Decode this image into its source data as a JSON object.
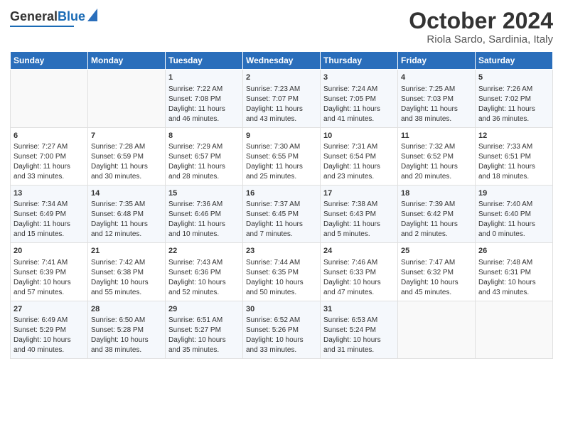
{
  "logo": {
    "general": "General",
    "blue": "Blue"
  },
  "title": {
    "month_year": "October 2024",
    "location": "Riola Sardo, Sardinia, Italy"
  },
  "headers": [
    "Sunday",
    "Monday",
    "Tuesday",
    "Wednesday",
    "Thursday",
    "Friday",
    "Saturday"
  ],
  "weeks": [
    [
      {
        "day": "",
        "lines": []
      },
      {
        "day": "",
        "lines": []
      },
      {
        "day": "1",
        "lines": [
          "Sunrise: 7:22 AM",
          "Sunset: 7:08 PM",
          "Daylight: 11 hours",
          "and 46 minutes."
        ]
      },
      {
        "day": "2",
        "lines": [
          "Sunrise: 7:23 AM",
          "Sunset: 7:07 PM",
          "Daylight: 11 hours",
          "and 43 minutes."
        ]
      },
      {
        "day": "3",
        "lines": [
          "Sunrise: 7:24 AM",
          "Sunset: 7:05 PM",
          "Daylight: 11 hours",
          "and 41 minutes."
        ]
      },
      {
        "day": "4",
        "lines": [
          "Sunrise: 7:25 AM",
          "Sunset: 7:03 PM",
          "Daylight: 11 hours",
          "and 38 minutes."
        ]
      },
      {
        "day": "5",
        "lines": [
          "Sunrise: 7:26 AM",
          "Sunset: 7:02 PM",
          "Daylight: 11 hours",
          "and 36 minutes."
        ]
      }
    ],
    [
      {
        "day": "6",
        "lines": [
          "Sunrise: 7:27 AM",
          "Sunset: 7:00 PM",
          "Daylight: 11 hours",
          "and 33 minutes."
        ]
      },
      {
        "day": "7",
        "lines": [
          "Sunrise: 7:28 AM",
          "Sunset: 6:59 PM",
          "Daylight: 11 hours",
          "and 30 minutes."
        ]
      },
      {
        "day": "8",
        "lines": [
          "Sunrise: 7:29 AM",
          "Sunset: 6:57 PM",
          "Daylight: 11 hours",
          "and 28 minutes."
        ]
      },
      {
        "day": "9",
        "lines": [
          "Sunrise: 7:30 AM",
          "Sunset: 6:55 PM",
          "Daylight: 11 hours",
          "and 25 minutes."
        ]
      },
      {
        "day": "10",
        "lines": [
          "Sunrise: 7:31 AM",
          "Sunset: 6:54 PM",
          "Daylight: 11 hours",
          "and 23 minutes."
        ]
      },
      {
        "day": "11",
        "lines": [
          "Sunrise: 7:32 AM",
          "Sunset: 6:52 PM",
          "Daylight: 11 hours",
          "and 20 minutes."
        ]
      },
      {
        "day": "12",
        "lines": [
          "Sunrise: 7:33 AM",
          "Sunset: 6:51 PM",
          "Daylight: 11 hours",
          "and 18 minutes."
        ]
      }
    ],
    [
      {
        "day": "13",
        "lines": [
          "Sunrise: 7:34 AM",
          "Sunset: 6:49 PM",
          "Daylight: 11 hours",
          "and 15 minutes."
        ]
      },
      {
        "day": "14",
        "lines": [
          "Sunrise: 7:35 AM",
          "Sunset: 6:48 PM",
          "Daylight: 11 hours",
          "and 12 minutes."
        ]
      },
      {
        "day": "15",
        "lines": [
          "Sunrise: 7:36 AM",
          "Sunset: 6:46 PM",
          "Daylight: 11 hours",
          "and 10 minutes."
        ]
      },
      {
        "day": "16",
        "lines": [
          "Sunrise: 7:37 AM",
          "Sunset: 6:45 PM",
          "Daylight: 11 hours",
          "and 7 minutes."
        ]
      },
      {
        "day": "17",
        "lines": [
          "Sunrise: 7:38 AM",
          "Sunset: 6:43 PM",
          "Daylight: 11 hours",
          "and 5 minutes."
        ]
      },
      {
        "day": "18",
        "lines": [
          "Sunrise: 7:39 AM",
          "Sunset: 6:42 PM",
          "Daylight: 11 hours",
          "and 2 minutes."
        ]
      },
      {
        "day": "19",
        "lines": [
          "Sunrise: 7:40 AM",
          "Sunset: 6:40 PM",
          "Daylight: 11 hours",
          "and 0 minutes."
        ]
      }
    ],
    [
      {
        "day": "20",
        "lines": [
          "Sunrise: 7:41 AM",
          "Sunset: 6:39 PM",
          "Daylight: 10 hours",
          "and 57 minutes."
        ]
      },
      {
        "day": "21",
        "lines": [
          "Sunrise: 7:42 AM",
          "Sunset: 6:38 PM",
          "Daylight: 10 hours",
          "and 55 minutes."
        ]
      },
      {
        "day": "22",
        "lines": [
          "Sunrise: 7:43 AM",
          "Sunset: 6:36 PM",
          "Daylight: 10 hours",
          "and 52 minutes."
        ]
      },
      {
        "day": "23",
        "lines": [
          "Sunrise: 7:44 AM",
          "Sunset: 6:35 PM",
          "Daylight: 10 hours",
          "and 50 minutes."
        ]
      },
      {
        "day": "24",
        "lines": [
          "Sunrise: 7:46 AM",
          "Sunset: 6:33 PM",
          "Daylight: 10 hours",
          "and 47 minutes."
        ]
      },
      {
        "day": "25",
        "lines": [
          "Sunrise: 7:47 AM",
          "Sunset: 6:32 PM",
          "Daylight: 10 hours",
          "and 45 minutes."
        ]
      },
      {
        "day": "26",
        "lines": [
          "Sunrise: 7:48 AM",
          "Sunset: 6:31 PM",
          "Daylight: 10 hours",
          "and 43 minutes."
        ]
      }
    ],
    [
      {
        "day": "27",
        "lines": [
          "Sunrise: 6:49 AM",
          "Sunset: 5:29 PM",
          "Daylight: 10 hours",
          "and 40 minutes."
        ]
      },
      {
        "day": "28",
        "lines": [
          "Sunrise: 6:50 AM",
          "Sunset: 5:28 PM",
          "Daylight: 10 hours",
          "and 38 minutes."
        ]
      },
      {
        "day": "29",
        "lines": [
          "Sunrise: 6:51 AM",
          "Sunset: 5:27 PM",
          "Daylight: 10 hours",
          "and 35 minutes."
        ]
      },
      {
        "day": "30",
        "lines": [
          "Sunrise: 6:52 AM",
          "Sunset: 5:26 PM",
          "Daylight: 10 hours",
          "and 33 minutes."
        ]
      },
      {
        "day": "31",
        "lines": [
          "Sunrise: 6:53 AM",
          "Sunset: 5:24 PM",
          "Daylight: 10 hours",
          "and 31 minutes."
        ]
      },
      {
        "day": "",
        "lines": []
      },
      {
        "day": "",
        "lines": []
      }
    ]
  ]
}
